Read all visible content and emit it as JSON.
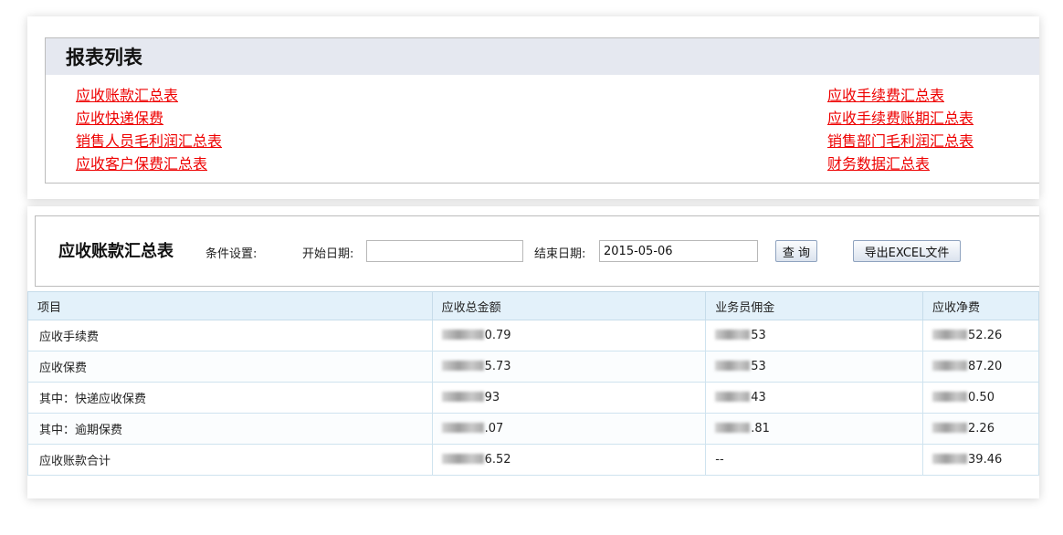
{
  "report_list": {
    "title": "报表列表",
    "left_links": [
      "应收账款汇总表",
      "应收快递保费",
      "销售人员毛利润汇总表",
      "应收客户保费汇总表"
    ],
    "right_links": [
      "应收手续费汇总表",
      "应收手续费账期汇总表",
      "销售部门毛利润汇总表",
      "财务数据汇总表"
    ]
  },
  "filter": {
    "title": "应收账款汇总表",
    "condition_label": "条件设置:",
    "start_label": "开始日期:",
    "start_value": "",
    "end_label": "结束日期:",
    "end_value": "2015-05-06",
    "query_button": "查 询",
    "export_button": "导出EXCEL文件"
  },
  "table": {
    "headers": [
      "项目",
      "应收总金额",
      "业务员佣金",
      "应收净费"
    ],
    "rows": [
      {
        "item": "应收手续费",
        "total": "0.79",
        "commission": "53",
        "net": "52.26"
      },
      {
        "item": "应收保费",
        "total": "5.73",
        "commission": "53",
        "net": "87.20"
      },
      {
        "item": "其中：快递应收保费",
        "total": "93",
        "commission": "43",
        "net": "0.50"
      },
      {
        "item": "其中：逾期保费",
        "total": ".07",
        "commission": ".81",
        "net": "2.26"
      },
      {
        "item": "应收账款合计",
        "total": "6.52",
        "commission": "--",
        "net": "39.46"
      }
    ],
    "redacted_cells": [
      "0.1",
      "0.2",
      "0.3",
      "1.1",
      "1.2",
      "1.3",
      "2.1",
      "2.2",
      "2.3",
      "3.1",
      "3.2",
      "3.3",
      "4.1",
      "4.3"
    ]
  },
  "colors": {
    "link": "#ee0000",
    "header_band": "#e5e8f0",
    "table_header": "#e3f1fa"
  }
}
